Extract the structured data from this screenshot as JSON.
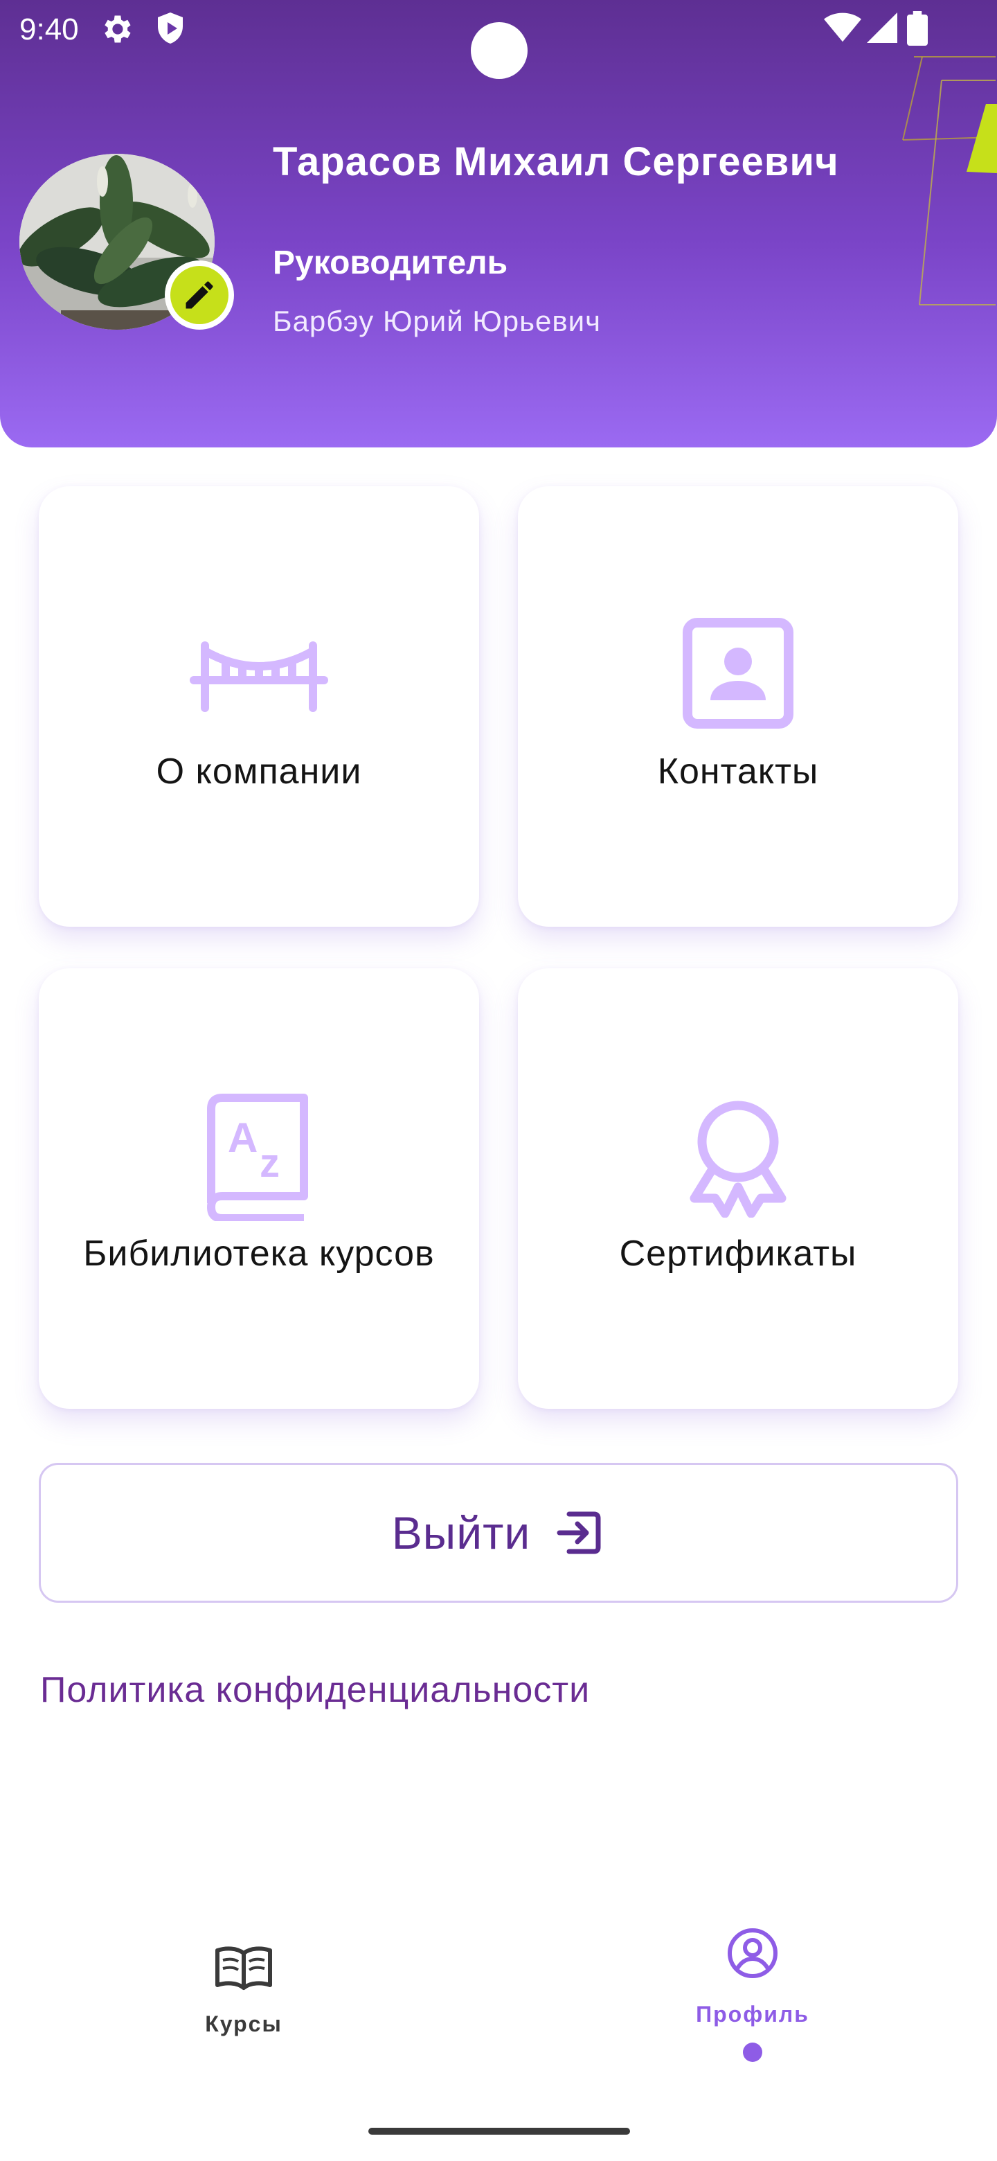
{
  "status_bar": {
    "time": "9:40"
  },
  "profile": {
    "name": "Тарасов Михаил Сергеевич",
    "role": "Руководитель",
    "manager": "Барбэу Юрий Юрьевич"
  },
  "tiles": [
    {
      "label": "О компании",
      "icon": "bridge-icon"
    },
    {
      "label": "Контакты",
      "icon": "contact-card-icon"
    },
    {
      "label": "Бибилиотека курсов",
      "icon": "dictionary-book-icon"
    },
    {
      "label": "Сертификаты",
      "icon": "award-ribbon-icon"
    }
  ],
  "logout": {
    "label": "Выйти",
    "icon": "logout-icon"
  },
  "privacy_link": "Политика конфиденциальности",
  "bottom_nav": {
    "items": [
      {
        "label": "Курсы",
        "icon": "open-book-icon",
        "active": false
      },
      {
        "label": "Профиль",
        "icon": "profile-circle-icon",
        "active": true
      }
    ]
  },
  "colors": {
    "header_top": "#5e2f93",
    "header_bottom": "#9b6af2",
    "accent": "#8e5ce6",
    "icon_tint": "#d4b8ff",
    "badge": "#c6e01a",
    "link": "#6a2c93"
  }
}
